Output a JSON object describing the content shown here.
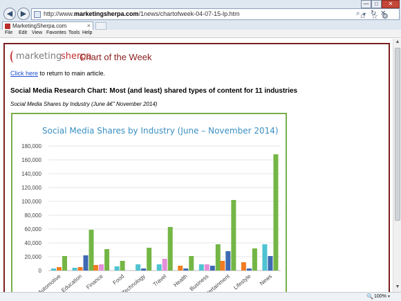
{
  "browser": {
    "url_prefix": "http://www.",
    "url_domain": "marketingsherpa.com",
    "url_path": "/1news/chartofweek-04-07-15-lp.htm",
    "tab_title": "MarketingSherpa.com",
    "menu": [
      "File",
      "Edit",
      "View",
      "Favorites",
      "Tools",
      "Help"
    ],
    "zoom": "100%",
    "icons": {
      "back": "◀",
      "forward": "▶",
      "search": "⌕",
      "dropdown": "▾",
      "refresh": "↻",
      "stop": "✕",
      "home": "⌂",
      "favorites": "☆",
      "settings": "⚙",
      "tab_close": "×",
      "minimize": "—",
      "maximize": "□",
      "close": "✕",
      "scroll_up": "▲",
      "scroll_down": "▼",
      "zoom": "🔍"
    }
  },
  "page": {
    "logo_part1": "marketing",
    "logo_part2": "sherpa",
    "heading": "Chart of the Week",
    "return_link": "Click here",
    "return_rest": " to return to main article.",
    "article_title": "Social Media Research Chart: Most (and least) shared types of content for 11 industries",
    "article_subtitle": "Social Media Shares by Industry (June â€” November 2014)"
  },
  "chart_data": {
    "type": "bar",
    "title": "Social Media Shares by Industry (June – November 2014)",
    "categories": [
      "Automotive",
      "Education",
      "Finance",
      "Food",
      "Technology",
      "Travel",
      "Health",
      "Business",
      "Entertainment",
      "Lifestyle",
      "News"
    ],
    "yticks": [
      "0",
      "20,000",
      "40,000",
      "60,000",
      "80,000",
      "100,000",
      "120,000",
      "140,000",
      "160,000",
      "180,000"
    ],
    "ylim": [
      0,
      180000
    ],
    "grid": true,
    "colors": [
      "#4fc3d2",
      "#f07d21",
      "#e48fd9",
      "#3e6ab4",
      "#74b645"
    ],
    "series_values": [
      [
        3000,
        4000,
        0,
        6000,
        9000,
        9000,
        0,
        9000,
        0,
        0,
        38000
      ],
      [
        5000,
        5000,
        8000,
        0,
        0,
        0,
        7000,
        0,
        14000,
        12000,
        0
      ],
      [
        0,
        0,
        9000,
        0,
        0,
        17000,
        0,
        9000,
        0,
        0,
        0
      ],
      [
        0,
        22000,
        0,
        0,
        3000,
        0,
        3000,
        7000,
        28000,
        3000,
        21000
      ],
      [
        21000,
        59000,
        31000,
        14000,
        33000,
        63000,
        21000,
        38000,
        102000,
        32000,
        168000
      ]
    ]
  }
}
